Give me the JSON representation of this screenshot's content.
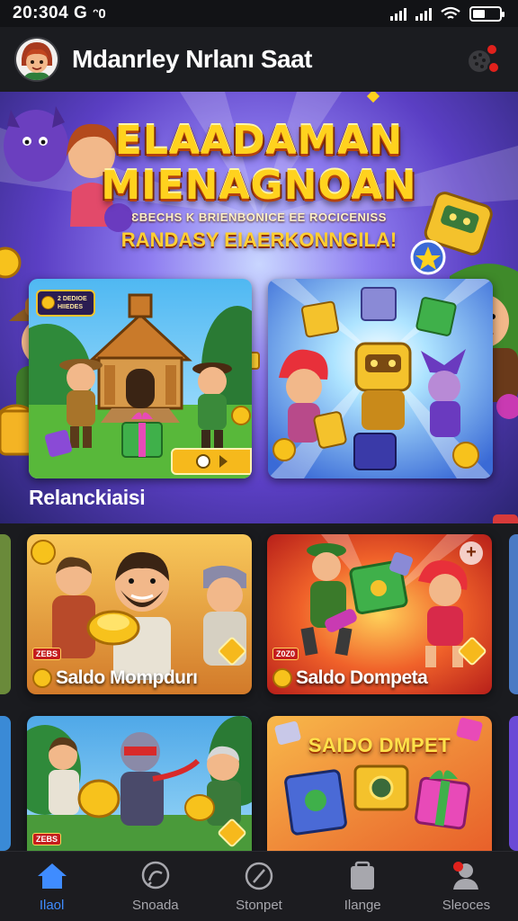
{
  "status_bar": {
    "time": "20:304 G",
    "extra": "ᵔ0",
    "battery_level_fraction": 0.45
  },
  "header": {
    "title": "Mdanrley Nrlanı Saat",
    "notifications_icon": "notification-badge-icon"
  },
  "hero": {
    "title_line1": "ELAADAMAN",
    "title_line2": "MIENAGNOAN",
    "subtitle": "ƐBECHS K BRIENBONICE EE ROCICENISS",
    "tagline": "RANDASY EIAERKONNGILA!",
    "card1_tag": "2 DEDIOE\nHIIEDES",
    "colors": {
      "title": "#ffd21e",
      "accent": "#f6b91c"
    }
  },
  "section": {
    "label": "Relanckiaisi"
  },
  "cards": [
    {
      "caption": "Saldo Mompdurı",
      "badge": "ZEBS"
    },
    {
      "caption": "Saldo Dompeta",
      "badge": "Z0Z0"
    },
    {
      "badge": "ZEBS"
    },
    {
      "banner": "SAIDO DMPET"
    }
  ],
  "bottom_nav": {
    "items": [
      {
        "label": "Ilaol",
        "icon": "home-icon",
        "active": true
      },
      {
        "label": "Snoada",
        "icon": "chat-icon",
        "active": false
      },
      {
        "label": "Stonpet",
        "icon": "compass-icon",
        "active": false
      },
      {
        "label": "Ilange",
        "icon": "store-icon",
        "active": false
      },
      {
        "label": "Sleoces",
        "icon": "profile-icon",
        "active": false
      }
    ],
    "active_color": "#3f8cff"
  }
}
